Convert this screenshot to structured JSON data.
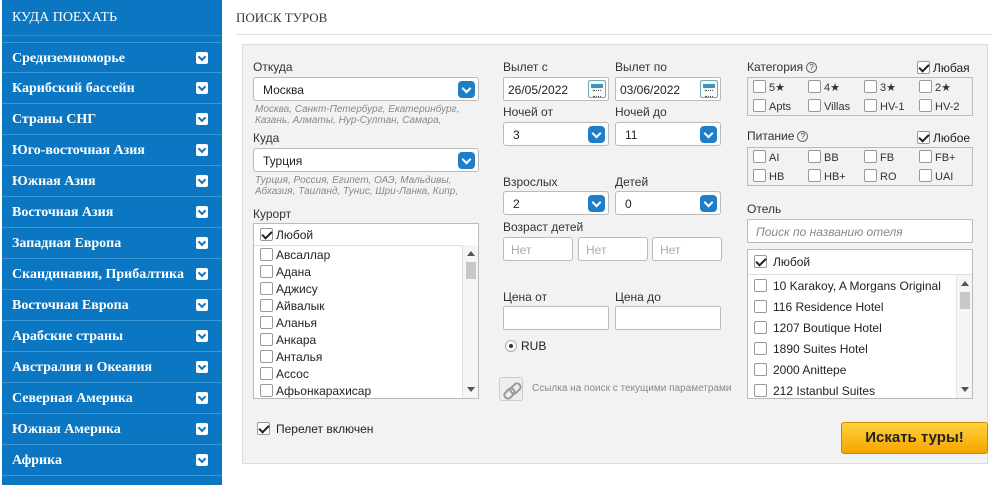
{
  "sidebar": {
    "title": "КУДА ПОЕХАТЬ",
    "items": [
      "Средиземноморье",
      "Карибский бассейн",
      "Страны СНГ",
      "Юго-восточная Азия",
      "Южная Азия",
      "Восточная Азия",
      "Западная Европа",
      "Скандинавия, Прибалтика",
      "Восточная Европа",
      "Арабские страны",
      "Австралия и Океания",
      "Северная Америка",
      "Южная Америка",
      "Африка"
    ]
  },
  "main": {
    "title": "ПОИСК ТУРОВ"
  },
  "form": {
    "from": {
      "label": "Откуда",
      "value": "Москва",
      "hint": "Москва, Санкт-Петербург, Екатеринбург, Казань, Алматы, Нур-Султан, Самара,"
    },
    "to": {
      "label": "Куда",
      "value": "Турция",
      "hint": "Турция, Россия, Египет, ОАЭ, Мальдивы, Абхазия, Таиланд, Тунис, Шри-Ланка, Кипр,"
    },
    "resort": {
      "label": "Курорт",
      "any": "Любой",
      "items": [
        "Авсаллар",
        "Адана",
        "Аджису",
        "Айвалык",
        "Аланья",
        "Анкара",
        "Анталья",
        "Ассос",
        "Афьонкарахисар"
      ]
    },
    "date_from": {
      "label": "Вылет с",
      "value": "26/05/2022"
    },
    "date_to": {
      "label": "Вылет по",
      "value": "03/06/2022"
    },
    "nights_from": {
      "label": "Ночей от",
      "value": "3"
    },
    "nights_to": {
      "label": "Ночей до",
      "value": "11"
    },
    "adults": {
      "label": "Взрослых",
      "value": "2"
    },
    "children": {
      "label": "Детей",
      "value": "0"
    },
    "child_ages": {
      "label": "Возраст детей",
      "values": [
        "Нет",
        "Нет",
        "Нет"
      ]
    },
    "price_from": {
      "label": "Цена от"
    },
    "price_to": {
      "label": "Цена до"
    },
    "currency": "RUB",
    "link_text": "Ссылка на поиск с текущими параметрами",
    "category": {
      "label": "Категория",
      "help": "?",
      "any": "Любая",
      "items": [
        "5★",
        "4★",
        "3★",
        "2★",
        "Apts",
        "Villas",
        "HV-1",
        "HV-2"
      ]
    },
    "meal": {
      "label": "Питание",
      "help": "?",
      "any": "Любое",
      "items": [
        "AI",
        "BB",
        "FB",
        "FB+",
        "HB",
        "HB+",
        "RO",
        "UAI"
      ]
    },
    "hotel": {
      "label": "Отель",
      "placeholder": "Поиск по названию отеля",
      "any": "Любой",
      "items": [
        "10 Karakoy, A Morgans Original",
        "116 Residence Hotel",
        "1207 Boutique Hotel",
        "1890 Suites Hotel",
        "2000 Anittepe",
        "212 Istanbul Suites"
      ]
    },
    "flight_included": "Перелет включен",
    "search_button": "Искать туры!"
  }
}
